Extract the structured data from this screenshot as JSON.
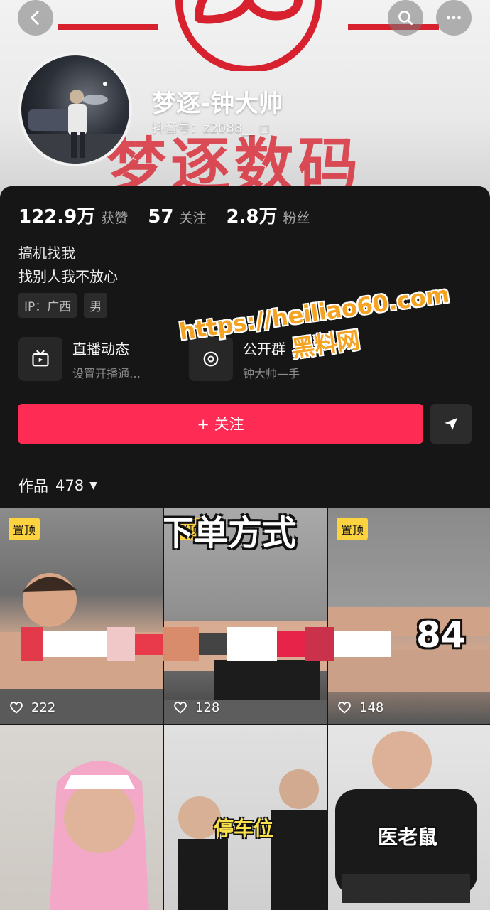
{
  "header": {
    "back_icon": "chevron-left-icon",
    "search_icon": "search-icon",
    "more_icon": "more-icon",
    "cover_text": "梦逐数码"
  },
  "profile": {
    "name": "梦逐-钟大帅",
    "douyin_id": "抖音号：z2088__ ◻"
  },
  "stats": [
    {
      "value": "122.9万",
      "label": "获赞"
    },
    {
      "value": "57",
      "label": "关注"
    },
    {
      "value": "2.8万",
      "label": "粉丝"
    }
  ],
  "bio": {
    "line1": "搞机找我",
    "line2": "找别人我不放心"
  },
  "tags": [
    "IP：广西",
    "男"
  ],
  "features": [
    {
      "title": "直播动态",
      "subtitle": "设置开播通…",
      "icon": "tv-icon"
    },
    {
      "title": "公开群",
      "subtitle": "钟大帅—手",
      "icon": "group-icon"
    }
  ],
  "actions": {
    "follow_label": "+ 关注",
    "share_icon": "send-icon"
  },
  "works_tab": {
    "label": "作品",
    "count": "478"
  },
  "watermark": {
    "line1": "https://heiliao60.com",
    "line2": "黑料网"
  },
  "videos": [
    {
      "pinned": "置顶",
      "likes": "222",
      "caption": ""
    },
    {
      "pinned": "置顶",
      "likes": "128",
      "caption": "下单方式"
    },
    {
      "pinned": "置顶",
      "likes": "148",
      "caption": "84"
    },
    {
      "pinned": "",
      "likes": "",
      "caption": ""
    },
    {
      "pinned": "",
      "likes": "",
      "caption": "停车位"
    },
    {
      "pinned": "",
      "likes": "",
      "caption": "医老鼠"
    }
  ],
  "colors": {
    "accent": "#fe2c55",
    "pin_badge": "#fdd340",
    "background": "#161616",
    "brand_red": "#d8212f",
    "watermark": "#f4a322"
  }
}
